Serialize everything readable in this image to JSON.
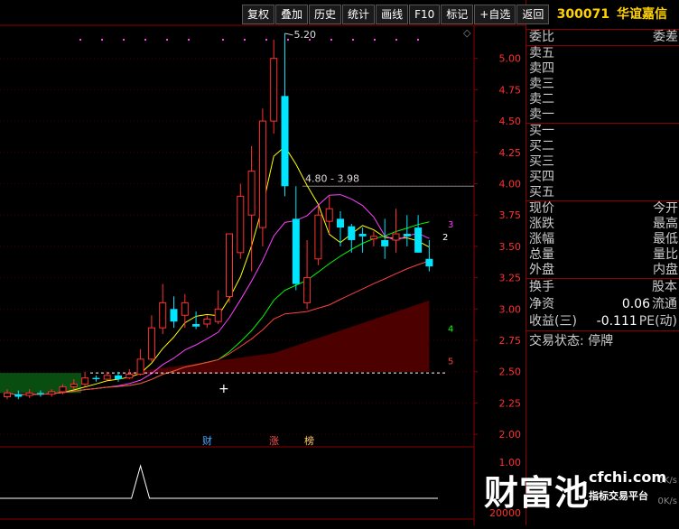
{
  "toolbar": {
    "buttons": [
      "复权",
      "叠加",
      "历史",
      "统计",
      "画线",
      "F10",
      "标记",
      "+自选",
      "返回"
    ]
  },
  "chart": {
    "price_axis": [
      "5.00",
      "4.75",
      "4.50",
      "4.25",
      "4.00",
      "3.75",
      "3.50",
      "3.25",
      "3.00",
      "2.75",
      "2.50",
      "2.25",
      "2.00"
    ],
    "volume_axis": [
      "1.00",
      "20000"
    ],
    "high_label": "5.20",
    "range_label": "4.80 - 3.98",
    "ma_labels": [
      "3",
      "2",
      "4",
      "5"
    ],
    "markers": [
      "财",
      "涨",
      "榜"
    ],
    "colors": {
      "up": "#ff3030",
      "down": "#00e5ff",
      "ma1": "#ffffff",
      "ma2": "#ffff00",
      "ma3": "#ff40ff",
      "ma4": "#00ff00",
      "ma5": "#ff4040"
    }
  },
  "chart_data": {
    "type": "candlestick",
    "ylim": [
      1.9,
      5.25
    ],
    "candles": [
      {
        "o": 2.3,
        "c": 2.33,
        "h": 2.36,
        "l": 2.28
      },
      {
        "o": 2.32,
        "c": 2.3,
        "h": 2.35,
        "l": 2.28
      },
      {
        "o": 2.31,
        "c": 2.33,
        "h": 2.36,
        "l": 2.29
      },
      {
        "o": 2.33,
        "c": 2.32,
        "h": 2.35,
        "l": 2.3
      },
      {
        "o": 2.32,
        "c": 2.34,
        "h": 2.36,
        "l": 2.3
      },
      {
        "o": 2.34,
        "c": 2.38,
        "h": 2.4,
        "l": 2.32
      },
      {
        "o": 2.38,
        "c": 2.4,
        "h": 2.44,
        "l": 2.36
      },
      {
        "o": 2.4,
        "c": 2.45,
        "h": 2.5,
        "l": 2.38
      },
      {
        "o": 2.45,
        "c": 2.44,
        "h": 2.47,
        "l": 2.42
      },
      {
        "o": 2.44,
        "c": 2.47,
        "h": 2.5,
        "l": 2.43
      },
      {
        "o": 2.47,
        "c": 2.44,
        "h": 2.5,
        "l": 2.42
      },
      {
        "o": 2.45,
        "c": 2.48,
        "h": 2.52,
        "l": 2.44
      },
      {
        "o": 2.48,
        "c": 2.6,
        "h": 2.68,
        "l": 2.47
      },
      {
        "o": 2.6,
        "c": 2.85,
        "h": 2.95,
        "l": 2.58
      },
      {
        "o": 2.85,
        "c": 3.05,
        "h": 3.2,
        "l": 2.8
      },
      {
        "o": 3.0,
        "c": 2.9,
        "h": 3.1,
        "l": 2.85
      },
      {
        "o": 2.95,
        "c": 3.05,
        "h": 3.12,
        "l": 2.85
      },
      {
        "o": 2.88,
        "c": 2.86,
        "h": 2.98,
        "l": 2.84
      },
      {
        "o": 2.88,
        "c": 2.92,
        "h": 2.95,
        "l": 2.85
      },
      {
        "o": 2.9,
        "c": 3.0,
        "h": 3.15,
        "l": 2.88
      },
      {
        "o": 3.1,
        "c": 3.6,
        "h": 3.6,
        "l": 3.05
      },
      {
        "o": 3.45,
        "c": 3.9,
        "h": 4.0,
        "l": 3.4
      },
      {
        "o": 3.75,
        "c": 4.1,
        "h": 4.3,
        "l": 3.3
      },
      {
        "o": 3.65,
        "c": 4.5,
        "h": 4.6,
        "l": 3.5
      },
      {
        "o": 4.5,
        "c": 5.0,
        "h": 5.15,
        "l": 4.4
      },
      {
        "o": 4.7,
        "c": 3.98,
        "h": 5.2,
        "l": 3.9
      },
      {
        "o": 3.72,
        "c": 3.2,
        "h": 3.98,
        "l": 3.15
      },
      {
        "o": 3.05,
        "c": 3.25,
        "h": 3.55,
        "l": 3.0
      },
      {
        "o": 3.4,
        "c": 3.75,
        "h": 3.82,
        "l": 3.35
      },
      {
        "o": 3.7,
        "c": 3.8,
        "h": 3.9,
        "l": 3.6
      },
      {
        "o": 3.72,
        "c": 3.65,
        "h": 3.78,
        "l": 3.5
      },
      {
        "o": 3.66,
        "c": 3.55,
        "h": 3.68,
        "l": 3.45
      },
      {
        "o": 3.6,
        "c": 3.58,
        "h": 3.65,
        "l": 3.45
      },
      {
        "o": 3.56,
        "c": 3.58,
        "h": 3.62,
        "l": 3.5
      },
      {
        "o": 3.55,
        "c": 3.5,
        "h": 3.72,
        "l": 3.4
      },
      {
        "o": 3.55,
        "c": 3.6,
        "h": 3.8,
        "l": 3.45
      },
      {
        "o": 3.6,
        "c": 3.58,
        "h": 3.75,
        "l": 3.5
      },
      {
        "o": 3.65,
        "c": 3.45,
        "h": 3.75,
        "l": 3.45
      },
      {
        "o": 3.4,
        "c": 3.34,
        "h": 3.55,
        "l": 3.3
      }
    ],
    "volume_peak_index": 12
  },
  "quote": {
    "code": "300071",
    "name": "华谊嘉信",
    "weibi_label": "委比",
    "weicha_label": "委差",
    "sell_levels": [
      "卖五",
      "卖四",
      "卖三",
      "卖二",
      "卖一"
    ],
    "buy_levels": [
      "买一",
      "买二",
      "买三",
      "买四",
      "买五"
    ],
    "stats": [
      {
        "l": "现价",
        "r": "今开"
      },
      {
        "l": "涨跌",
        "r": "最高"
      },
      {
        "l": "涨幅",
        "r": "最低"
      },
      {
        "l": "总量",
        "r": "量比"
      },
      {
        "l": "外盘",
        "r": "内盘"
      }
    ],
    "info": [
      {
        "k": "换手",
        "v": "",
        "k2": "股本"
      },
      {
        "k": "净资",
        "v": "0.06",
        "k2": "流通"
      },
      {
        "k": "收益(三)",
        "v": "-0.111",
        "k2": "PE(动)"
      }
    ],
    "trade_status": "交易状态: 停牌"
  },
  "logo": {
    "brand": "财富池",
    "domain": "cfchi.com",
    "slogan": "指标交易平台"
  },
  "net_speed": [
    "0K/s",
    "0K/s"
  ]
}
